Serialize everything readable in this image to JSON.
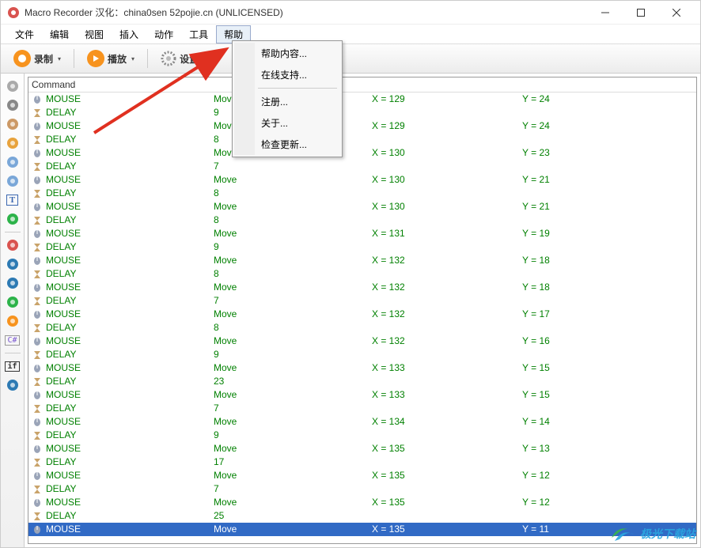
{
  "window": {
    "title": "Macro Recorder 汉化：china0sen 52pojie.cn (UNLICENSED)"
  },
  "menubar": {
    "items": [
      "文件",
      "编辑",
      "视图",
      "插入",
      "动作",
      "工具",
      "帮助"
    ],
    "active_index": 6
  },
  "dropdown": {
    "groups": [
      [
        "帮助内容...",
        "在线支持..."
      ],
      [
        "注册...",
        "关于...",
        "检查更新..."
      ]
    ]
  },
  "toolbar": {
    "record_label": "录制",
    "play_label": "播放",
    "settings_label": "设置"
  },
  "left_tools": [
    {
      "name": "mouse-tool-icon",
      "color": "#aaa"
    },
    {
      "name": "keyboard-tool-icon",
      "color": "#888"
    },
    {
      "name": "delay-tool-icon",
      "color": "#c96"
    },
    {
      "name": "print-tool-icon",
      "color": "#e8a33d"
    },
    {
      "name": "copy-tool-icon",
      "color": "#7aa7d8"
    },
    {
      "name": "paste-tool-icon",
      "color": "#7aa7d8"
    },
    {
      "name": "text-tool-icon",
      "color": "#3a66b0"
    },
    {
      "name": "color-picker-icon",
      "color": "#2db34a"
    },
    {
      "name": "sep",
      "color": ""
    },
    {
      "name": "power-tool-icon",
      "color": "#d9534f"
    },
    {
      "name": "globe-tool-icon",
      "color": "#2d7ab3"
    },
    {
      "name": "info-tool-icon",
      "color": "#2d7ab3"
    },
    {
      "name": "run-tool-icon",
      "color": "#2db34a"
    },
    {
      "name": "play-tool-icon",
      "color": "#f7931e"
    },
    {
      "name": "csharp-tool-icon",
      "color": "#7a57d1"
    },
    {
      "name": "sep",
      "color": ""
    },
    {
      "name": "if-tool-icon",
      "color": "#333"
    },
    {
      "name": "loop-tool-icon",
      "color": "#2d7ab3"
    }
  ],
  "list": {
    "header": "Command",
    "rows": [
      {
        "type": "MOUSE",
        "p1": "Move",
        "p2": "X = 129",
        "p3": "Y = 24"
      },
      {
        "type": "DELAY",
        "p1": "9",
        "p2": "",
        "p3": ""
      },
      {
        "type": "MOUSE",
        "p1": "Move",
        "p2": "X = 129",
        "p3": "Y = 24"
      },
      {
        "type": "DELAY",
        "p1": "8",
        "p2": "",
        "p3": ""
      },
      {
        "type": "MOUSE",
        "p1": "Move",
        "p2": "X = 130",
        "p3": "Y = 23"
      },
      {
        "type": "DELAY",
        "p1": "7",
        "p2": "",
        "p3": ""
      },
      {
        "type": "MOUSE",
        "p1": "Move",
        "p2": "X = 130",
        "p3": "Y = 21"
      },
      {
        "type": "DELAY",
        "p1": "8",
        "p2": "",
        "p3": ""
      },
      {
        "type": "MOUSE",
        "p1": "Move",
        "p2": "X = 130",
        "p3": "Y = 21"
      },
      {
        "type": "DELAY",
        "p1": "8",
        "p2": "",
        "p3": ""
      },
      {
        "type": "MOUSE",
        "p1": "Move",
        "p2": "X = 131",
        "p3": "Y = 19"
      },
      {
        "type": "DELAY",
        "p1": "9",
        "p2": "",
        "p3": ""
      },
      {
        "type": "MOUSE",
        "p1": "Move",
        "p2": "X = 132",
        "p3": "Y = 18"
      },
      {
        "type": "DELAY",
        "p1": "8",
        "p2": "",
        "p3": ""
      },
      {
        "type": "MOUSE",
        "p1": "Move",
        "p2": "X = 132",
        "p3": "Y = 18"
      },
      {
        "type": "DELAY",
        "p1": "7",
        "p2": "",
        "p3": ""
      },
      {
        "type": "MOUSE",
        "p1": "Move",
        "p2": "X = 132",
        "p3": "Y = 17"
      },
      {
        "type": "DELAY",
        "p1": "8",
        "p2": "",
        "p3": ""
      },
      {
        "type": "MOUSE",
        "p1": "Move",
        "p2": "X = 132",
        "p3": "Y = 16"
      },
      {
        "type": "DELAY",
        "p1": "9",
        "p2": "",
        "p3": ""
      },
      {
        "type": "MOUSE",
        "p1": "Move",
        "p2": "X = 133",
        "p3": "Y = 15"
      },
      {
        "type": "DELAY",
        "p1": "23",
        "p2": "",
        "p3": ""
      },
      {
        "type": "MOUSE",
        "p1": "Move",
        "p2": "X = 133",
        "p3": "Y = 15"
      },
      {
        "type": "DELAY",
        "p1": "7",
        "p2": "",
        "p3": ""
      },
      {
        "type": "MOUSE",
        "p1": "Move",
        "p2": "X = 134",
        "p3": "Y = 14"
      },
      {
        "type": "DELAY",
        "p1": "9",
        "p2": "",
        "p3": ""
      },
      {
        "type": "MOUSE",
        "p1": "Move",
        "p2": "X = 135",
        "p3": "Y = 13"
      },
      {
        "type": "DELAY",
        "p1": "17",
        "p2": "",
        "p3": ""
      },
      {
        "type": "MOUSE",
        "p1": "Move",
        "p2": "X = 135",
        "p3": "Y = 12"
      },
      {
        "type": "DELAY",
        "p1": "7",
        "p2": "",
        "p3": ""
      },
      {
        "type": "MOUSE",
        "p1": "Move",
        "p2": "X = 135",
        "p3": "Y = 12"
      },
      {
        "type": "DELAY",
        "p1": "25",
        "p2": "",
        "p3": ""
      },
      {
        "type": "MOUSE",
        "p1": "Move",
        "p2": "X = 135",
        "p3": "Y = 11",
        "selected": true
      }
    ]
  },
  "watermark": {
    "text": "极光下载站",
    "sub": ""
  }
}
